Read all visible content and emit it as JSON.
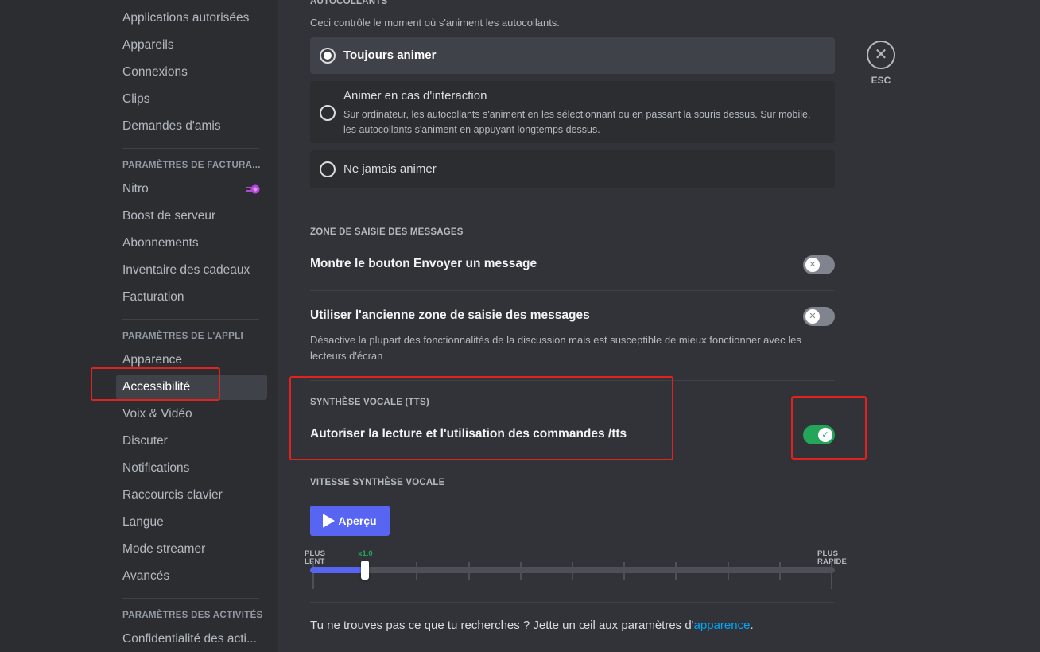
{
  "sidebar": {
    "items_top": [
      {
        "label": "Applications autorisées"
      },
      {
        "label": "Appareils"
      },
      {
        "label": "Connexions"
      },
      {
        "label": "Clips"
      },
      {
        "label": "Demandes d'amis"
      }
    ],
    "billing_header": "PARAMÈTRES DE FACTURA...",
    "billing_items": [
      {
        "label": "Nitro",
        "icon": "nitro-icon"
      },
      {
        "label": "Boost de serveur"
      },
      {
        "label": "Abonnements"
      },
      {
        "label": "Inventaire des cadeaux"
      },
      {
        "label": "Facturation"
      }
    ],
    "app_header": "PARAMÈTRES DE L'APPLI",
    "app_items": [
      {
        "label": "Apparence"
      },
      {
        "label": "Accessibilité",
        "selected": true
      },
      {
        "label": "Voix & Vidéo"
      },
      {
        "label": "Discuter"
      },
      {
        "label": "Notifications"
      },
      {
        "label": "Raccourcis clavier"
      },
      {
        "label": "Langue"
      },
      {
        "label": "Mode streamer"
      },
      {
        "label": "Avancés"
      }
    ],
    "activity_header": "PARAMÈTRES DES ACTIVITÉS",
    "activity_items": [
      {
        "label": "Confidentialité des acti..."
      }
    ]
  },
  "stickers": {
    "title": "AUTOCOLLANTS",
    "description": "Ceci contrôle le moment où s'animent les autocollants.",
    "options": [
      {
        "label": "Toujours animer",
        "selected": true
      },
      {
        "label": "Animer en cas d'interaction",
        "description": "Sur ordinateur, les autocollants s'animent en les sélectionnant ou en passant la souris dessus. Sur mobile, les autocollants s'animent en appuyant longtemps dessus.",
        "selected": false
      },
      {
        "label": "Ne jamais animer",
        "selected": false
      }
    ]
  },
  "message_input": {
    "title": "ZONE DE SAISIE DES MESSAGES",
    "settings": [
      {
        "label": "Montre le bouton Envoyer un message",
        "enabled": false,
        "knob_glyph": "✕"
      },
      {
        "label": "Utiliser l'ancienne zone de saisie des messages",
        "enabled": false,
        "knob_glyph": "✕",
        "description": "Désactive la plupart des fonctionnalités de la discussion mais est susceptible de mieux fonctionner avec les lecteurs d'écran"
      }
    ]
  },
  "tts": {
    "title": "SYNTHÈSE VOCALE (TTS)",
    "setting": {
      "label": "Autoriser la lecture et l'utilisation des commandes /tts",
      "enabled": true,
      "knob_glyph": "✓"
    }
  },
  "tts_speed": {
    "title": "VITESSE SYNTHÈSE VOCALE",
    "preview_label": "Aperçu",
    "slow_label_1": "PLUS",
    "slow_label_2": "LENT",
    "fast_label_1": "PLUS",
    "fast_label_2": "RAPIDE",
    "value_label": "x1.0",
    "value_fraction": 0.1,
    "tick_count": 11
  },
  "footer": {
    "text": "Tu ne trouves pas ce que tu recherches ? Jette un œil aux paramètres d'",
    "link": "apparence",
    "suffix": "."
  },
  "close": {
    "glyph": "✕",
    "label": "ESC"
  },
  "colors": {
    "accent": "#5865f2",
    "toggle_on": "#23a55a",
    "toggle_off": "#80848e",
    "link": "#00a8fc",
    "annotation": "#e0231c"
  }
}
